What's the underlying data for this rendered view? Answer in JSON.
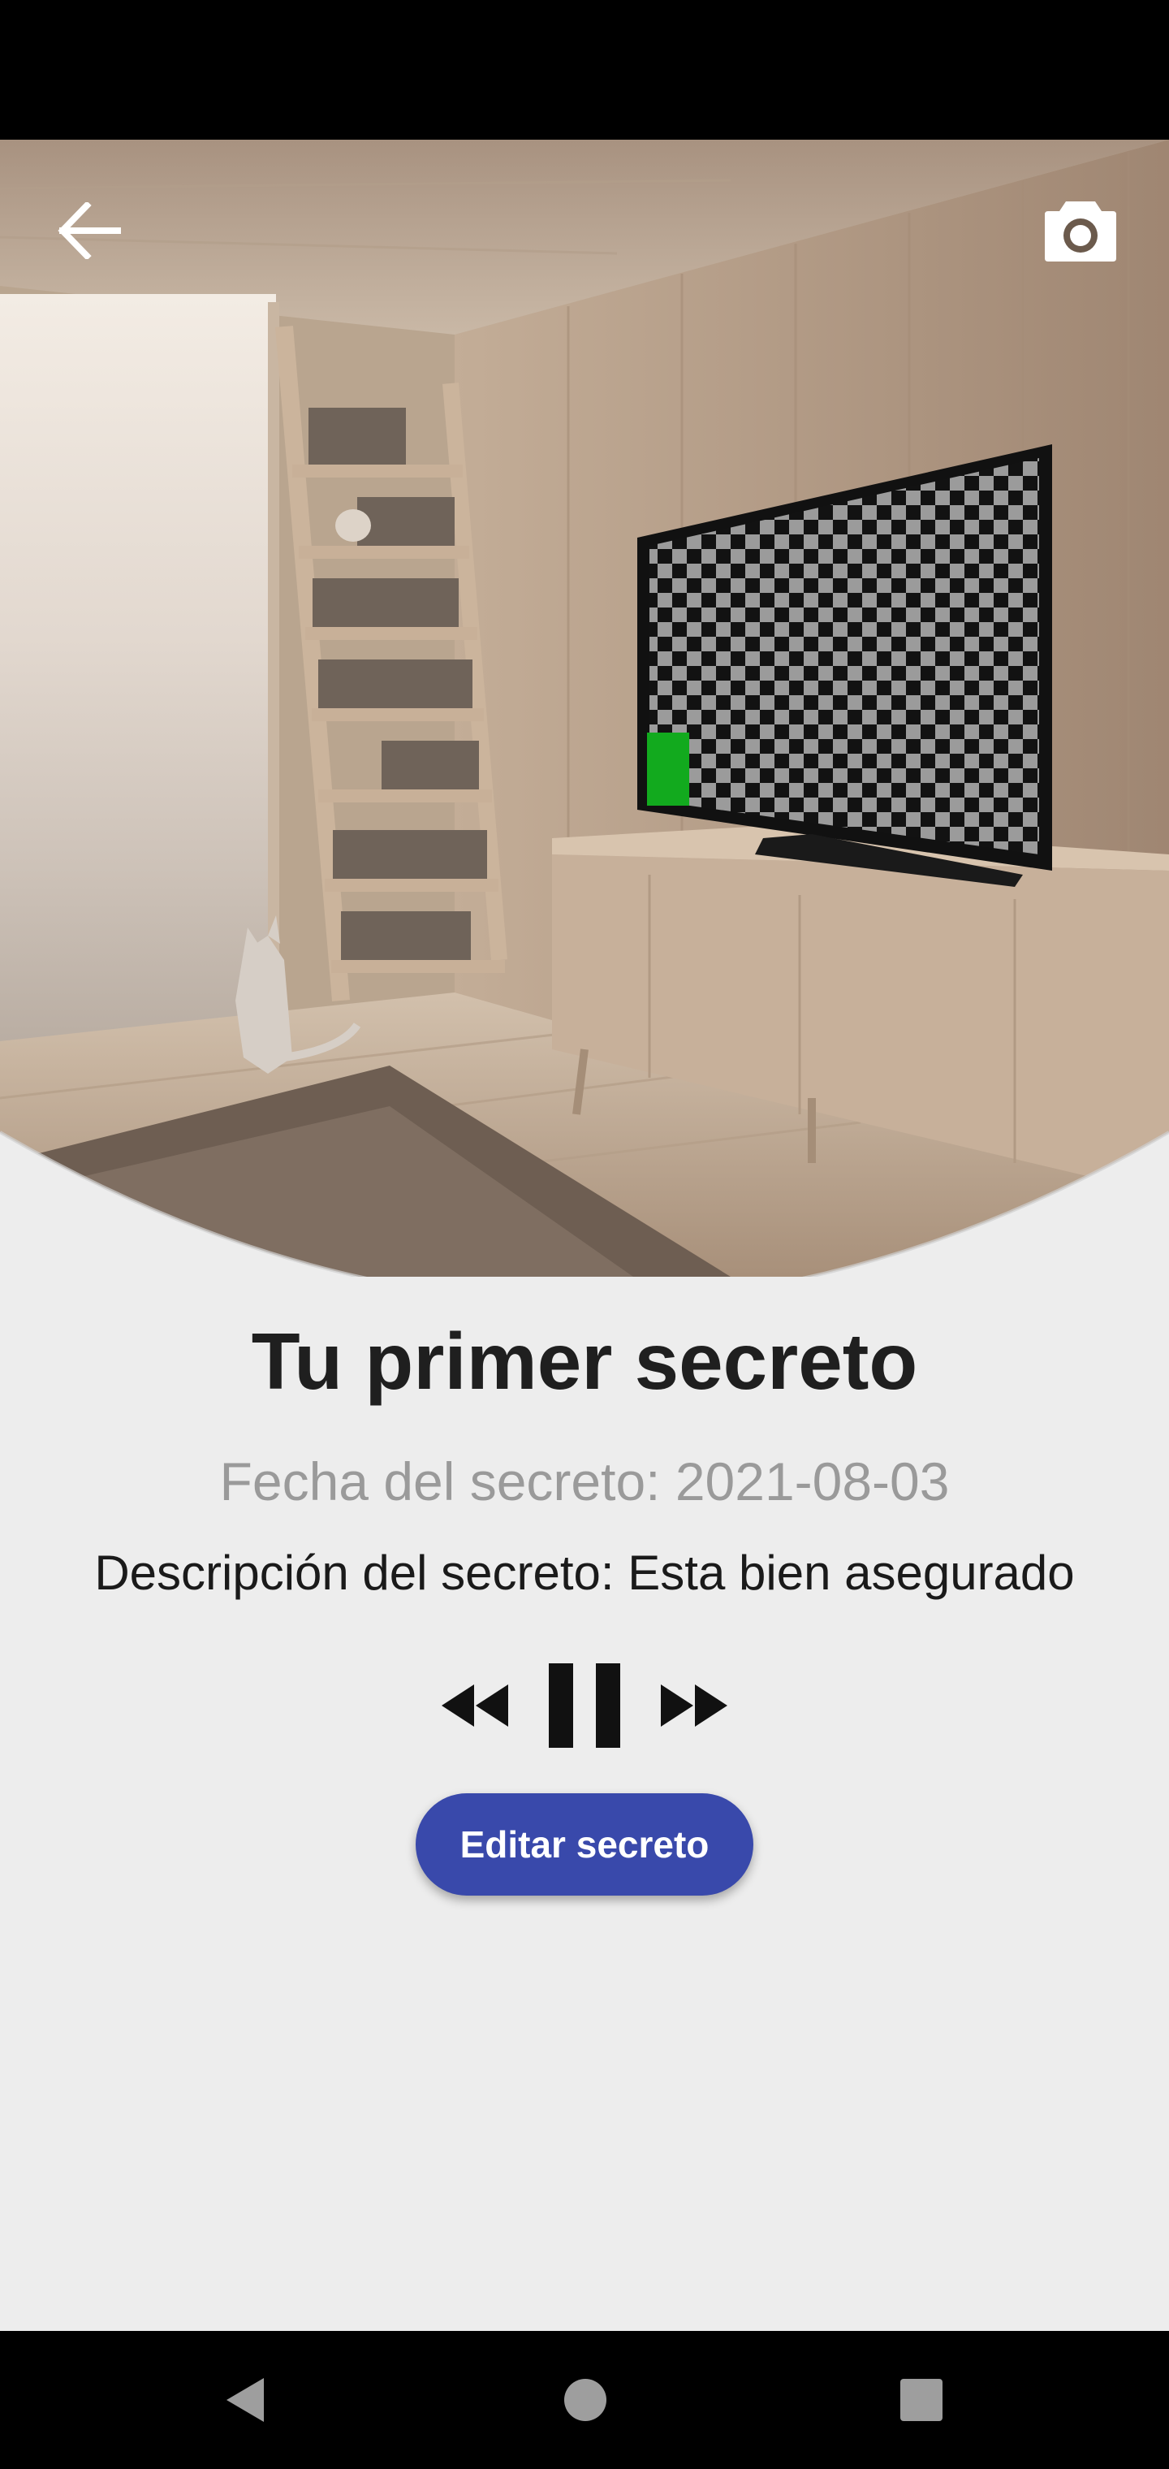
{
  "secret": {
    "title": "Tu primer secreto",
    "date_text": "Fecha del secreto: 2021-08-03",
    "description_text": "Descripción del secreto: Esta bien asegurado"
  },
  "actions": {
    "edit_label": "Editar secreto"
  },
  "icons": {
    "back": "arrow-back-icon",
    "camera": "camera-icon",
    "rewind": "rewind-icon",
    "pause": "pause-icon",
    "fast_forward": "fast-forward-icon",
    "nav_back": "nav-back-icon",
    "nav_home": "nav-home-icon",
    "nav_recent": "nav-recent-icon"
  },
  "colors": {
    "accent": "#3949ab",
    "background": "#ededed",
    "title": "#1f1f1f",
    "date": "#9a9a9a"
  }
}
